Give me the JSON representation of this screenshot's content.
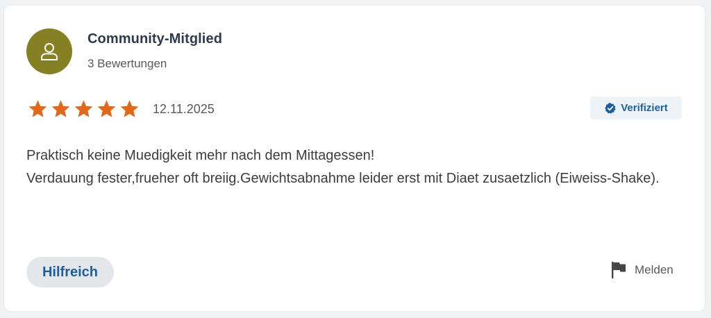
{
  "review": {
    "author": {
      "name": "Community-Mitglied",
      "review_count": "3 Bewertungen",
      "avatar_icon": "user-icon",
      "avatar_color": "#858024"
    },
    "rating": {
      "stars": 5,
      "max": 5,
      "star_color": "#e2691c"
    },
    "date": "12.11.2025",
    "badge": {
      "label": "Verifiziert",
      "icon": "verified-check-icon",
      "color": "#1d5f9e"
    },
    "text_lines": [
      "Praktisch keine Muedigkeit mehr nach dem Mittagessen!",
      "Verdauung fester,frueher oft breiig.Gewichtsabnahme leider erst mit Diaet zusaetzlich (Eiweiss-Shake)."
    ],
    "actions": {
      "helpful_label": "Hilfreich",
      "report_label": "Melden",
      "report_icon": "flag-icon"
    }
  }
}
